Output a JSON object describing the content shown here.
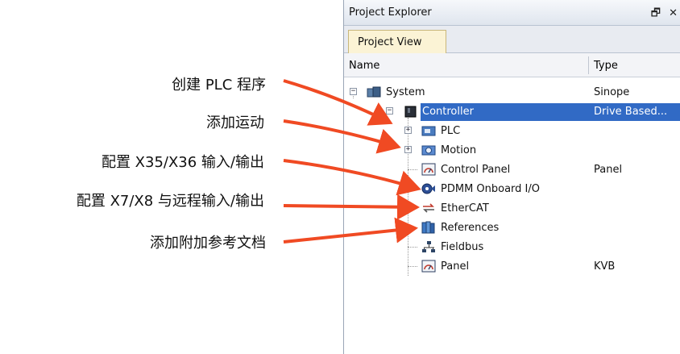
{
  "annotations": [
    "创建 PLC 程序",
    "添加运动",
    "配置 X35/X36 输入/输出",
    "配置 X7/X8 与远程输入/输出",
    "添加附加参考文档"
  ],
  "colors": {
    "arrow": "#f04a23",
    "selection": "#316ac5",
    "tab_active": "#fbf3d5"
  },
  "panel": {
    "title": "Project Explorer",
    "title_icons": [
      "pin-icon",
      "close-icon"
    ],
    "pin_glyph": "🗗",
    "close_glyph": "✕",
    "tab": "Project View",
    "columns": {
      "name": "Name",
      "type": "Type"
    },
    "tree": [
      {
        "label": "System",
        "type": "Sinope",
        "icon": "system-icon"
      },
      {
        "label": "Controller",
        "type": "Drive Based...",
        "icon": "controller-icon",
        "selected": true
      },
      {
        "label": "PLC",
        "type": "",
        "icon": "plc-icon"
      },
      {
        "label": "Motion",
        "type": "",
        "icon": "motion-icon"
      },
      {
        "label": "Control Panel",
        "type": "Panel",
        "icon": "gauge-icon"
      },
      {
        "label": "PDMM Onboard I/O",
        "type": "",
        "icon": "io-icon"
      },
      {
        "label": "EtherCAT",
        "type": "",
        "icon": "ethercat-icon"
      },
      {
        "label": "References",
        "type": "",
        "icon": "books-icon"
      },
      {
        "label": "Fieldbus",
        "type": "",
        "icon": "network-icon"
      },
      {
        "label": "Panel",
        "type": "KVB",
        "icon": "gauge-icon"
      }
    ]
  }
}
